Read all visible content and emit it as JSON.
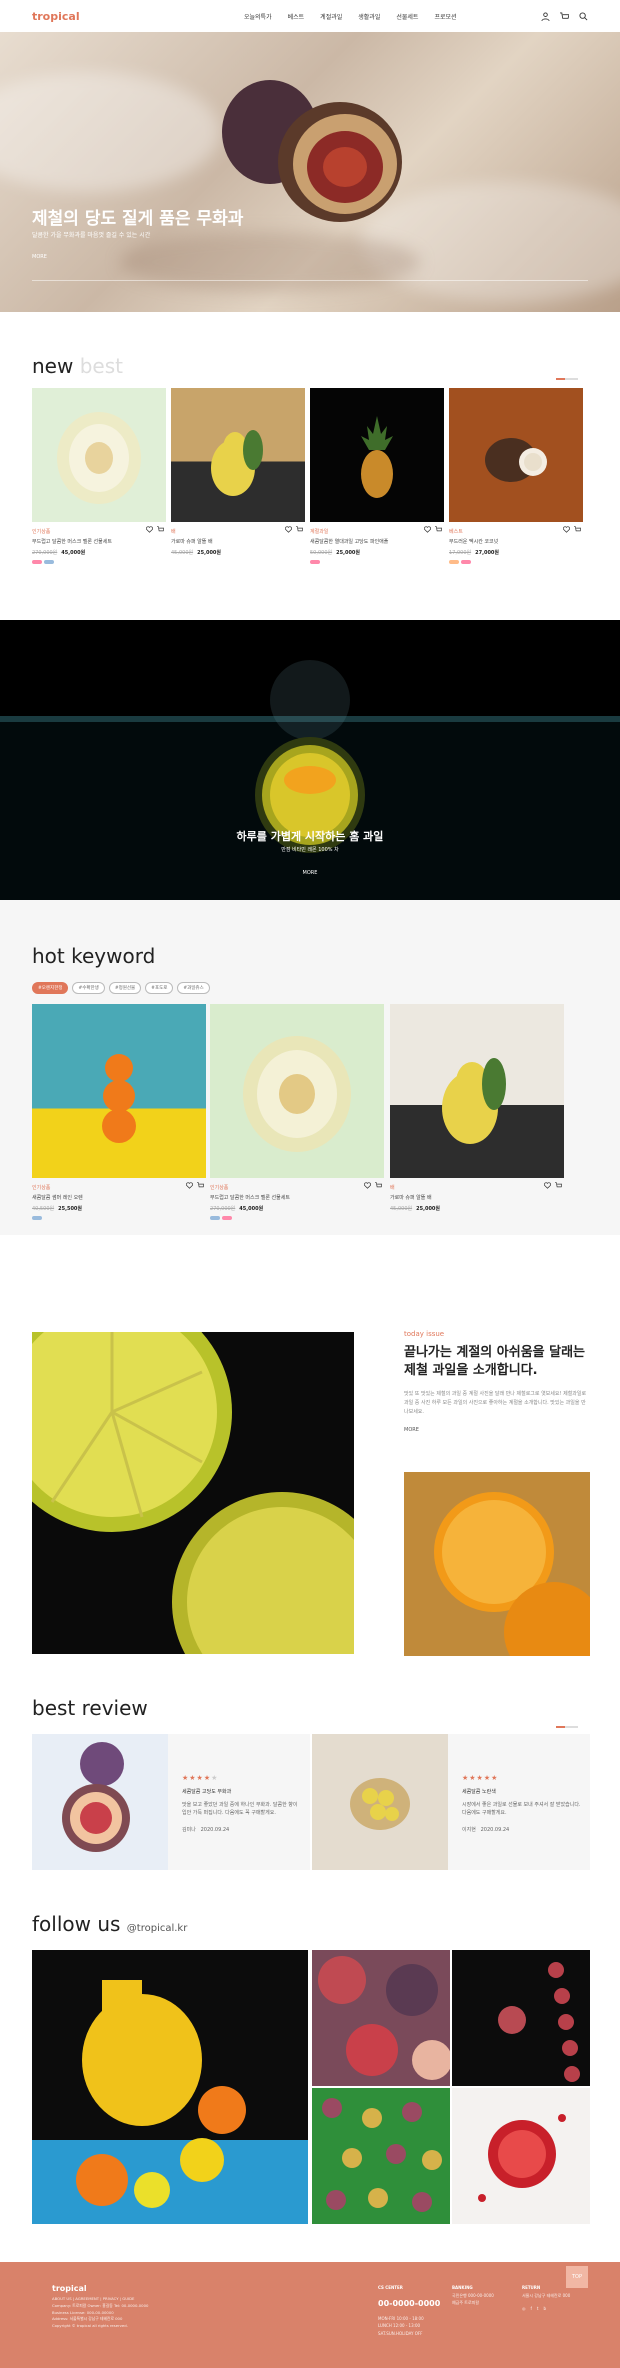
{
  "header": {
    "logo": "tropical",
    "nav": [
      "오늘의특가",
      "베스트",
      "계절과일",
      "생활과일",
      "선물세트",
      "프로모션"
    ],
    "icons": [
      "user-icon",
      "cart-icon",
      "search-icon"
    ]
  },
  "hero": {
    "title": "제철의 당도 짙게 품은 무화과",
    "subtitle": "달콤한 가을 무화과를 마음껏 즐길 수 있는 시간",
    "more": "MORE"
  },
  "new_section": {
    "title": "new",
    "ghost": "best",
    "products": [
      {
        "category": "인기상품",
        "name": "부드럽고 달콤한 머스크 멜론 선물세트",
        "old": "270,000원",
        "price": "45,000원",
        "badges": [
          "#f8a",
          " #9bd"
        ]
      },
      {
        "category": "배",
        "name": "가로마 슈퍼 알뜰 배",
        "old": "45,000원",
        "price": "25,000원",
        "badges": []
      },
      {
        "category": "계절과일",
        "name": "새콤달콤한 열대과일 고당도 파인애플",
        "old": "50,000원",
        "price": "25,000원",
        "badges": [
          "#f8a"
        ]
      },
      {
        "category": "베스트",
        "name": "부드러운 멕시칸 코코넛",
        "old": "17,000원",
        "price": "27,000원",
        "badges": [
          "#fb8",
          "#f8a"
        ]
      }
    ]
  },
  "banner": {
    "title": "하루를 가볍게 시작하는 홈 과일",
    "subtitle": "만점 비타민 레몬 100% 차",
    "more": "MORE"
  },
  "hot": {
    "title": "hot keyword",
    "chips": [
      "#오렌지한정",
      "#수확한생",
      "#정원선물",
      "#포도로",
      "#과일쥬스"
    ],
    "products": [
      {
        "category": "인기상품",
        "name": "새콤달콤 썸머 레인 오렌",
        "old": "40,500원",
        "price": "25,500원",
        "badges": [
          "#9bd"
        ]
      },
      {
        "category": "인기상품",
        "name": "부드럽고 달콤한 머스크 멜론 선물세트",
        "old": "270,000원",
        "price": "45,000원",
        "badges": [
          "#9bd",
          "#f8a"
        ]
      },
      {
        "category": "배",
        "name": "가로마 슈퍼 알뜰 배",
        "old": "45,000원",
        "price": "25,000원",
        "badges": []
      }
    ]
  },
  "today": {
    "label": "today issue",
    "title": "끝나가는 계절의 아쉬움을 달래는 제철 과일을 소개합니다.",
    "body": "맛있 또 맛있는 제철의 과일 중 계절 사진을 달래 만나 제철로그로 엿보세요! 제철과일로 과일 중 사진 하루 모든 과일의 사진으로 좋아하는 계절을 소개합니다. 맛있는 과일을 만나보세요.",
    "more": "MORE"
  },
  "review": {
    "title": "best review",
    "items": [
      {
        "stars": 4,
        "product": "세콤달콤 고당도 무화과",
        "text": "맛을 보고 좋았던 과일 중에 하나인 무화과. 달콤한 향이 입안 가득 퍼집니다. 다음에도 꼭 구매할게요.",
        "user": "김미나",
        "date": "2020.09.24"
      },
      {
        "stars": 5,
        "product": "세콤달콤 노란색",
        "text": "시장에서 좋은 과일로 선물로 보내 주셔서 잘 받았습니다. 다음에도 구매할게요.",
        "user": "이지현",
        "date": "2020.09.24"
      }
    ]
  },
  "follow": {
    "title": "follow us",
    "handle": "@tropical.kr"
  },
  "footer": {
    "logo": "tropical",
    "info": [
      "ABOUT US | AGREEMENT | PRIVACY | GUIDE",
      "Company: 트로피칼  Owner: 홍길동  Tel: 00-0000-0000",
      "Business License: 000-00-00000",
      "Address: 서울특별시 강남구 테헤란로 000",
      "Copyright © tropical all rights reserved."
    ],
    "cs_label": "CS CENTER",
    "tel": "00-0000-0000",
    "cs_lines": [
      "MON-FRI 10:00 - 18:00",
      "LUNCH 12:00 - 13:00",
      "SAT.SUN.HOLIDAY OFF"
    ],
    "bank_label": "BANKING",
    "bank_lines": [
      "국민은행 000-00-0000",
      "예금주 트로피칼"
    ],
    "return_label": "RETURN",
    "return_lines": [
      "서울시 강남구 테헤란로 000"
    ],
    "top": "TOP"
  },
  "colors": {
    "accent": "#e0775a",
    "footer": "#d9826a"
  }
}
